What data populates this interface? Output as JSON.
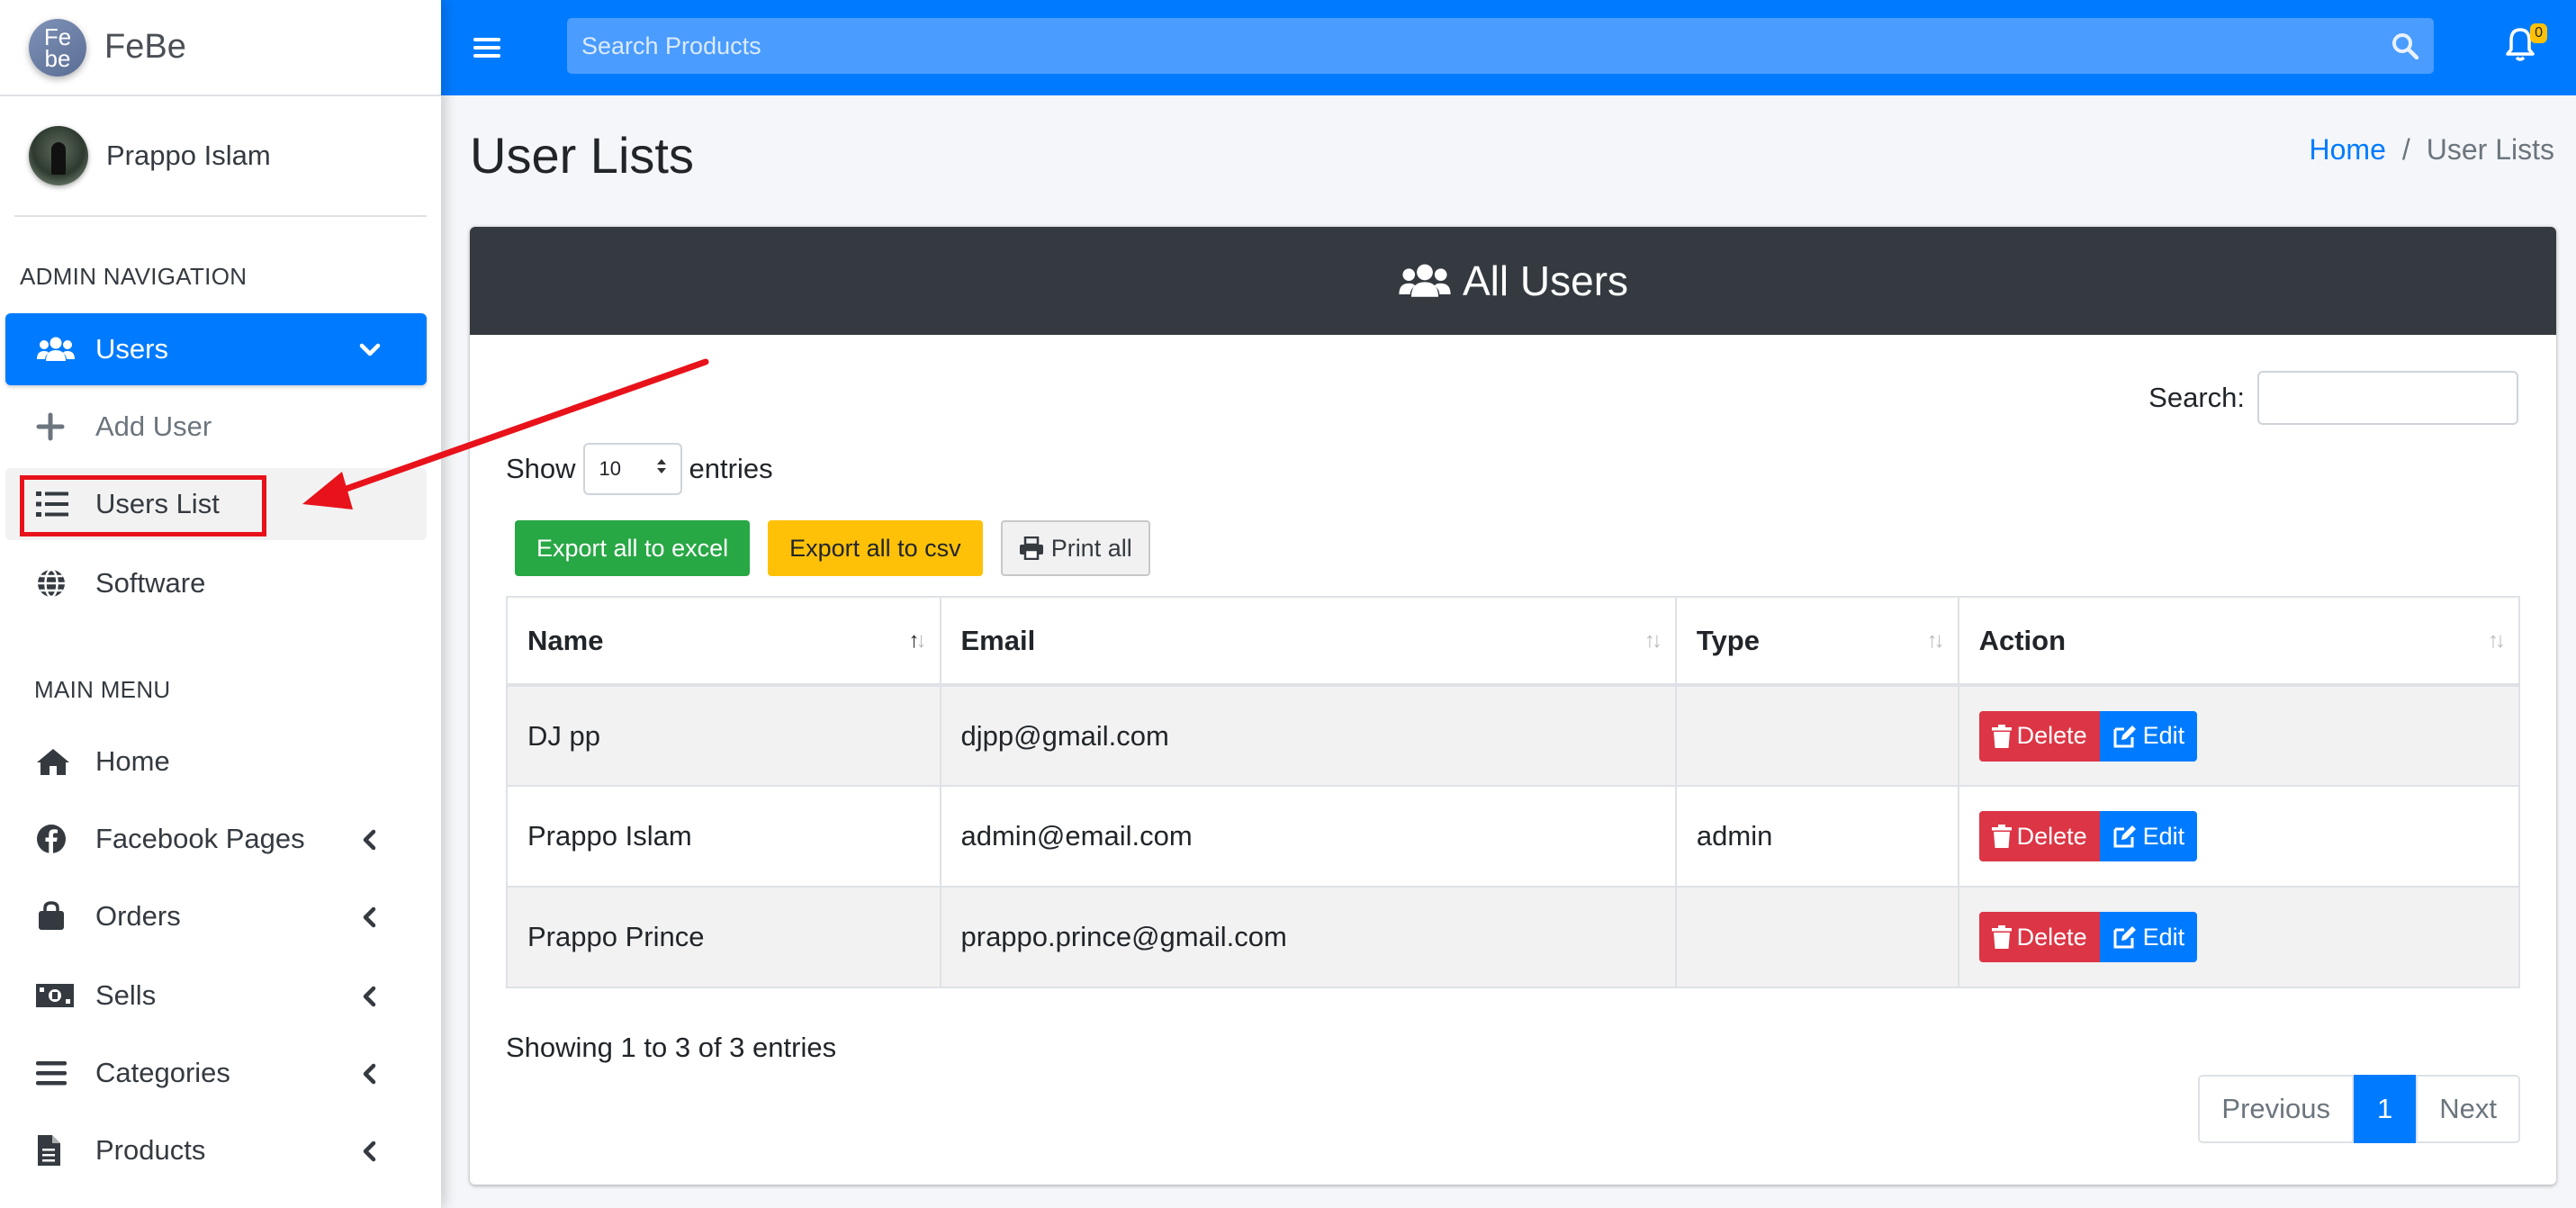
{
  "brand": {
    "name": "FeBe",
    "logo_text_top": "Fe",
    "logo_text_bottom": "be"
  },
  "user": {
    "name": "Prappo Islam"
  },
  "sidebar": {
    "admin_header": "ADMIN NAVIGATION",
    "users_label": "Users",
    "add_user_label": "Add User",
    "users_list_label": "Users List",
    "software_label": "Software",
    "main_header": "MAIN MENU",
    "home_label": "Home",
    "facebook_label": "Facebook Pages",
    "orders_label": "Orders",
    "sells_label": "Sells",
    "categories_label": "Categories",
    "products_label": "Products"
  },
  "topbar": {
    "search_placeholder": "Search Products",
    "notification_count": "0"
  },
  "content": {
    "page_title": "User Lists",
    "breadcrumb_home": "Home",
    "breadcrumb_sep": "/",
    "breadcrumb_current": "User Lists"
  },
  "card": {
    "title": "All Users",
    "search_label": "Search:",
    "show_label": "Show",
    "entries_label": "entries",
    "page_length": "10",
    "btn_excel": "Export all to excel",
    "btn_csv": "Export all to csv",
    "btn_print": "Print all"
  },
  "table": {
    "col_name": "Name",
    "col_email": "Email",
    "col_type": "Type",
    "col_action": "Action",
    "delete_label": "Delete",
    "edit_label": "Edit",
    "rows": [
      {
        "name": "DJ pp",
        "email": "djpp@gmail.com",
        "type": ""
      },
      {
        "name": "Prappo Islam",
        "email": "admin@email.com",
        "type": "admin"
      },
      {
        "name": "Prappo Prince",
        "email": "prappo.prince@gmail.com",
        "type": ""
      }
    ]
  },
  "footer": {
    "info": "Showing 1 to 3 of 3 entries",
    "prev": "Previous",
    "current_page": "1",
    "next": "Next"
  },
  "colors": {
    "primary": "#007bff",
    "dark_header": "#343a40",
    "excel": "#28a745",
    "csv": "#ffc107",
    "delete": "#dc3545",
    "annotation": "#e8121b"
  },
  "icons": {
    "users": "users-icon",
    "add": "plus-icon",
    "list": "list-icon",
    "software": "globe-icon",
    "home": "home-icon",
    "facebook": "facebook-icon",
    "orders": "shopping-bag-icon",
    "sells": "money-bill-icon",
    "categories": "bars-icon",
    "products": "file-icon"
  }
}
